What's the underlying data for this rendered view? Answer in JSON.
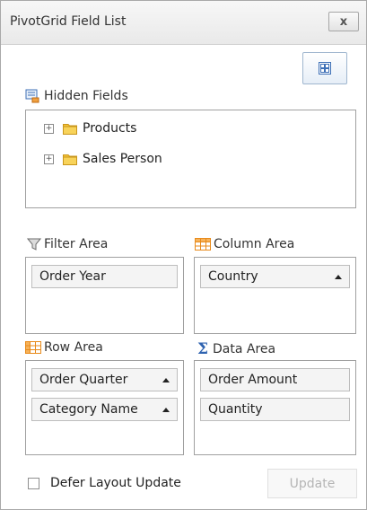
{
  "window": {
    "title": "PivotGrid Field List",
    "close_label": "x"
  },
  "hidden_fields": {
    "label": "Hidden Fields",
    "items": [
      {
        "label": "Products"
      },
      {
        "label": "Sales Person"
      }
    ]
  },
  "areas": {
    "filter": {
      "label": "Filter Area",
      "fields": [
        "Order Year"
      ]
    },
    "column": {
      "label": "Column Area",
      "fields": [
        "Country"
      ]
    },
    "row": {
      "label": "Row Area",
      "fields": [
        "Order Quarter",
        "Category Name"
      ]
    },
    "data": {
      "label": "Data Area",
      "fields": [
        "Order Amount",
        "Quantity"
      ]
    }
  },
  "footer": {
    "defer_label": "Defer Layout Update",
    "update_label": "Update"
  },
  "colors": {
    "folder": "#f5c338",
    "grid_icon": "#3d6fb6",
    "table_icon": "#e88a1a"
  }
}
